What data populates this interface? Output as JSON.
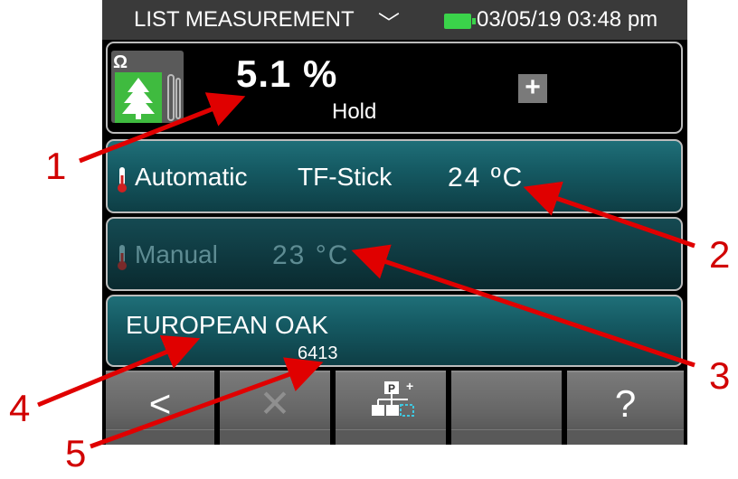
{
  "status_bar": {
    "title": "LIST MEASUREMENT",
    "datetime": "03/05/19 03:48 pm",
    "battery_color": "#3ad34a"
  },
  "measurement": {
    "value": "5.1 %",
    "state": "Hold",
    "add_label": "+",
    "omega_symbol": "Ω",
    "species_icon": "tree-icon"
  },
  "auto_temp": {
    "mode": "Automatic",
    "sensor": "TF-Stick",
    "temperature": "24 ºC"
  },
  "manual_temp": {
    "mode": "Manual",
    "temperature": "23 °C"
  },
  "wood": {
    "name": "EUROPEAN OAK",
    "code": "6413"
  },
  "toolbar": {
    "back": "<",
    "delete": "✕",
    "hierarchy_icon": "hierarchy-add-icon",
    "help": "?"
  },
  "callouts": [
    "1",
    "2",
    "3",
    "4",
    "5"
  ],
  "colors": {
    "panel_teal": "#155a63",
    "arrow_red": "#e00000"
  }
}
